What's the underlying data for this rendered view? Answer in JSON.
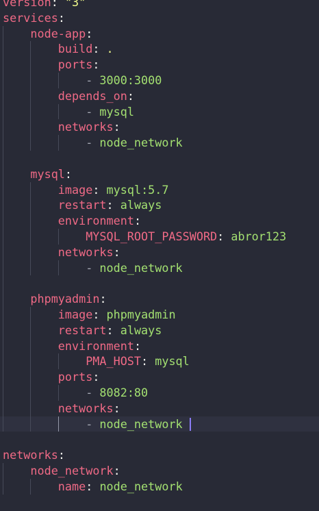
{
  "editor": {
    "language": "yaml",
    "colors": {
      "background": "#282a36",
      "current_line": "#2f3140",
      "key": "#f06a86",
      "string": "#f1fa8c",
      "value": "#a3e071",
      "punctuation": "#f8f8f2",
      "dash": "#a5a8b4",
      "cursor": "#8b7cf6",
      "indent_guide": "#474a59"
    },
    "current_line_index": 27,
    "lines": [
      {
        "indent": 0,
        "parts": [
          {
            "cls": "k",
            "text": "version"
          },
          {
            "cls": "p",
            "text": ": "
          },
          {
            "cls": "s",
            "text": "\"3\""
          }
        ]
      },
      {
        "indent": 0,
        "parts": [
          {
            "cls": "k",
            "text": "services"
          },
          {
            "cls": "p",
            "text": ":"
          }
        ]
      },
      {
        "indent": 1,
        "parts": [
          {
            "cls": "k",
            "text": "node-app"
          },
          {
            "cls": "p",
            "text": ":"
          }
        ]
      },
      {
        "indent": 2,
        "parts": [
          {
            "cls": "k",
            "text": "build"
          },
          {
            "cls": "p",
            "text": ": "
          },
          {
            "cls": "s",
            "text": "."
          }
        ]
      },
      {
        "indent": 2,
        "parts": [
          {
            "cls": "k",
            "text": "ports"
          },
          {
            "cls": "p",
            "text": ":"
          }
        ]
      },
      {
        "indent": 3,
        "parts": [
          {
            "cls": "d",
            "text": "- "
          },
          {
            "cls": "v",
            "text": "3000:3000"
          }
        ]
      },
      {
        "indent": 2,
        "parts": [
          {
            "cls": "k",
            "text": "depends_on"
          },
          {
            "cls": "p",
            "text": ":"
          }
        ]
      },
      {
        "indent": 3,
        "parts": [
          {
            "cls": "d",
            "text": "- "
          },
          {
            "cls": "v",
            "text": "mysql"
          }
        ]
      },
      {
        "indent": 2,
        "parts": [
          {
            "cls": "k",
            "text": "networks"
          },
          {
            "cls": "p",
            "text": ":"
          }
        ]
      },
      {
        "indent": 3,
        "parts": [
          {
            "cls": "d",
            "text": "- "
          },
          {
            "cls": "v",
            "text": "node_network"
          }
        ]
      },
      {
        "indent": 1,
        "parts": []
      },
      {
        "indent": 1,
        "parts": [
          {
            "cls": "k",
            "text": "mysql"
          },
          {
            "cls": "p",
            "text": ":"
          }
        ]
      },
      {
        "indent": 2,
        "parts": [
          {
            "cls": "k",
            "text": "image"
          },
          {
            "cls": "p",
            "text": ": "
          },
          {
            "cls": "v",
            "text": "mysql:5.7"
          }
        ]
      },
      {
        "indent": 2,
        "parts": [
          {
            "cls": "k",
            "text": "restart"
          },
          {
            "cls": "p",
            "text": ": "
          },
          {
            "cls": "v",
            "text": "always"
          }
        ]
      },
      {
        "indent": 2,
        "parts": [
          {
            "cls": "k",
            "text": "environment"
          },
          {
            "cls": "p",
            "text": ":"
          }
        ]
      },
      {
        "indent": 3,
        "parts": [
          {
            "cls": "k",
            "text": "MYSQL_ROOT_PASSWORD"
          },
          {
            "cls": "p",
            "text": ": "
          },
          {
            "cls": "v",
            "text": "abror123"
          }
        ]
      },
      {
        "indent": 2,
        "parts": [
          {
            "cls": "k",
            "text": "networks"
          },
          {
            "cls": "p",
            "text": ":"
          }
        ]
      },
      {
        "indent": 3,
        "parts": [
          {
            "cls": "d",
            "text": "- "
          },
          {
            "cls": "v",
            "text": "node_network"
          }
        ]
      },
      {
        "indent": 1,
        "parts": []
      },
      {
        "indent": 1,
        "parts": [
          {
            "cls": "k",
            "text": "phpmyadmin"
          },
          {
            "cls": "p",
            "text": ":"
          }
        ]
      },
      {
        "indent": 2,
        "parts": [
          {
            "cls": "k",
            "text": "image"
          },
          {
            "cls": "p",
            "text": ": "
          },
          {
            "cls": "v",
            "text": "phpmyadmin"
          }
        ]
      },
      {
        "indent": 2,
        "parts": [
          {
            "cls": "k",
            "text": "restart"
          },
          {
            "cls": "p",
            "text": ": "
          },
          {
            "cls": "v",
            "text": "always"
          }
        ]
      },
      {
        "indent": 2,
        "parts": [
          {
            "cls": "k",
            "text": "environment"
          },
          {
            "cls": "p",
            "text": ":"
          }
        ]
      },
      {
        "indent": 3,
        "parts": [
          {
            "cls": "k",
            "text": "PMA_HOST"
          },
          {
            "cls": "p",
            "text": ": "
          },
          {
            "cls": "v",
            "text": "mysql"
          }
        ]
      },
      {
        "indent": 2,
        "parts": [
          {
            "cls": "k",
            "text": "ports"
          },
          {
            "cls": "p",
            "text": ":"
          }
        ]
      },
      {
        "indent": 3,
        "parts": [
          {
            "cls": "d",
            "text": "- "
          },
          {
            "cls": "v",
            "text": "8082:80"
          }
        ]
      },
      {
        "indent": 2,
        "parts": [
          {
            "cls": "k",
            "text": "networks"
          },
          {
            "cls": "p",
            "text": ":"
          }
        ]
      },
      {
        "indent": 3,
        "parts": [
          {
            "cls": "d",
            "text": "- "
          },
          {
            "cls": "v",
            "text": "node_network"
          }
        ],
        "cursor": true
      },
      {
        "indent": 0,
        "parts": []
      },
      {
        "indent": 0,
        "parts": [
          {
            "cls": "k",
            "text": "networks"
          },
          {
            "cls": "p",
            "text": ":"
          }
        ]
      },
      {
        "indent": 1,
        "parts": [
          {
            "cls": "k",
            "text": "node_network"
          },
          {
            "cls": "p",
            "text": ":"
          }
        ]
      },
      {
        "indent": 2,
        "parts": [
          {
            "cls": "k",
            "text": "name"
          },
          {
            "cls": "p",
            "text": ": "
          },
          {
            "cls": "v",
            "text": "node_network"
          }
        ]
      }
    ]
  }
}
